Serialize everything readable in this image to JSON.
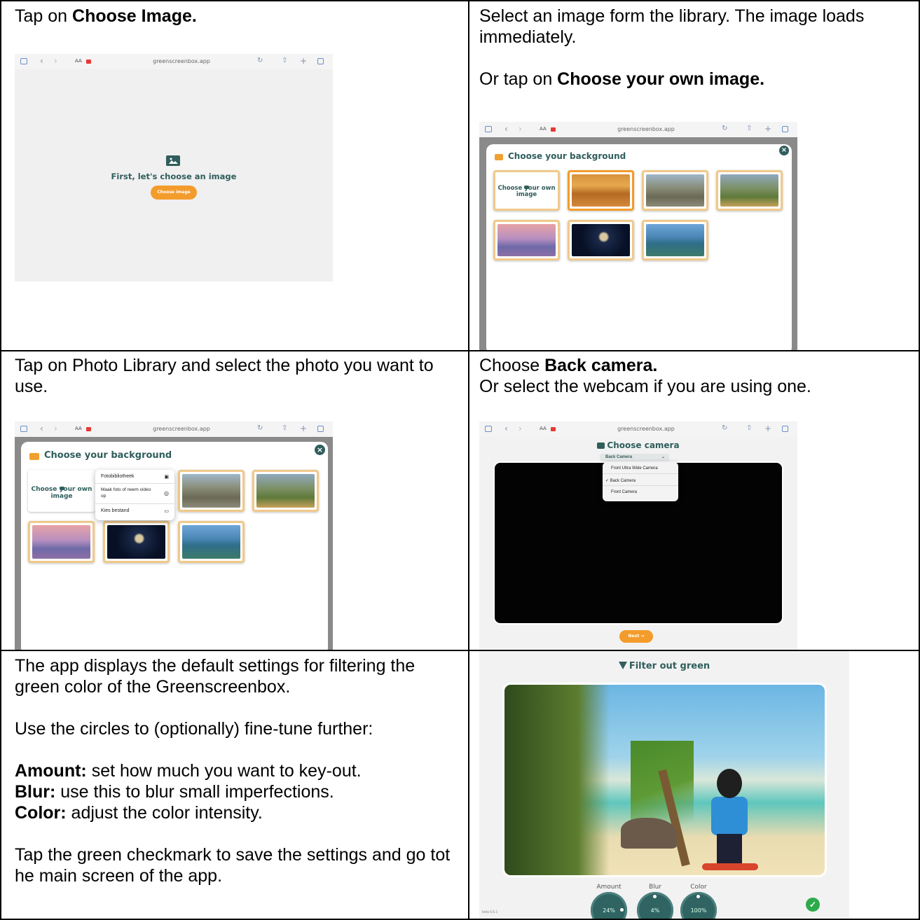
{
  "cells": {
    "c1": {
      "pre": "Tap on ",
      "bold": "Choose Image."
    },
    "c2": {
      "p1": "Select an image form the library. The image loads immediately.",
      "p2_pre": "Or tap on ",
      "p2_bold": "Choose your own image."
    },
    "c3": {
      "p1": "Tap on Photo Library and select the photo you want to use."
    },
    "c4": {
      "l1_pre": "Choose ",
      "l1_bold": "Back camera.",
      "l2": "Or select the webcam if you are using one."
    },
    "c5": {
      "p1": "The app displays the default settings for filtering the green color of the Greenscreenbox.",
      "p2": "Use the circles to (optionally) fine-tune further:",
      "amount_label": "Amount:",
      "amount_text": " set how much you want to key-out.",
      "blur_label": "Blur:",
      "blur_text": " use this to blur small imperfections.",
      "color_label": "Color:",
      "color_text": " adjust the color intensity.",
      "p4": "Tap the green checkmark to save the settings and go tot he main screen of the app."
    }
  },
  "browser": {
    "url": "greenscreenbox.app",
    "aa": "AA"
  },
  "shot1": {
    "heading": "First, let's choose an image",
    "button": "Choose image"
  },
  "dialog": {
    "title": "Choose your background",
    "own_image": "Choose your own image",
    "close": "×"
  },
  "menu": {
    "items": [
      "Fotobibliotheek",
      "Maak foto of neem video op",
      "Kies bestand"
    ]
  },
  "camera": {
    "title": "Choose camera",
    "selected": "Back Camera",
    "options": [
      "Front Ultra Wide Camera",
      "Back Camera",
      "Front Camera"
    ],
    "check": "✓",
    "next": "Next →"
  },
  "filter": {
    "title": "Filter out green",
    "amount_label": "Amount",
    "blur_label": "Blur",
    "color_label": "Color",
    "amount_value": "24%",
    "blur_value": "4%",
    "color_value": "100%",
    "version": "beta 6.6.1"
  },
  "colors": {
    "teal": "#2f5e5c",
    "orange": "#f39c2b",
    "green": "#2eaa4a"
  }
}
